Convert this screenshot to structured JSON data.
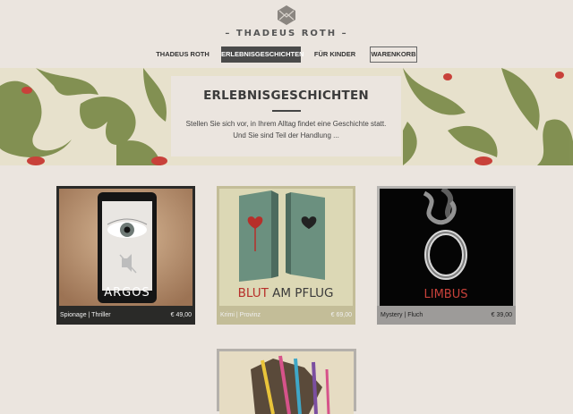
{
  "brand": {
    "name": "THADEUS ROTH",
    "dash": "–"
  },
  "nav": {
    "items": [
      "THADEUS ROTH",
      "ERLEBNISGESCHICHTEN",
      "FÜR KINDER",
      "WARENKORB"
    ]
  },
  "banner": {
    "title": "ERLEBNISGESCHICHTEN",
    "text_line1": "Stellen Sie sich vor, in Ihrem Alltag findet eine Geschichte statt.",
    "text_line2": "Und Sie sind Teil der Handlung ..."
  },
  "products": [
    {
      "title": "ARGOS",
      "genre": "Spionage | Thriller",
      "price": "€ 49,00"
    },
    {
      "title_part1": "BLUT",
      "title_part2": " AM PFLUG",
      "genre": "Krimi | Provinz",
      "price": "€ 69,00"
    },
    {
      "title": "LIMBUS",
      "genre": "Mystery | Fluch",
      "price": "€ 39,00"
    }
  ],
  "colors": {
    "background": "#ebe5df",
    "active_nav": "#4a4a4a",
    "accent_red": "#c8413a",
    "pattern_green": "#7d8c4c"
  }
}
